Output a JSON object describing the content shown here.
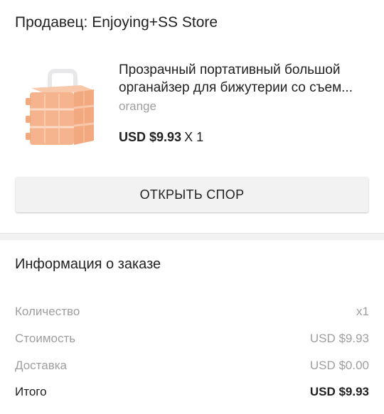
{
  "seller": {
    "text": "Продавец: Enjoying+SS Store"
  },
  "product": {
    "image_icon": "organizer-box-image",
    "title_line1": "Прозрачный портативный большой",
    "title_line2": "органайзер для бижутерии со съем...",
    "variant": "orange",
    "price": "USD $9.93",
    "quantity": "X 1"
  },
  "actions": {
    "open_dispute_label": "ОТКРЫТЬ СПОР"
  },
  "order_info": {
    "title": "Информация о заказе",
    "rows": [
      {
        "label": "Количество",
        "value": "x1"
      },
      {
        "label": "Стоимость",
        "value": "USD $9.93"
      },
      {
        "label": "Доставка",
        "value": "USD $0.00"
      },
      {
        "label": "Итого",
        "value": "USD $9.93"
      }
    ]
  },
  "colors": {
    "text_primary": "#212121",
    "text_secondary": "#9e9e9e",
    "button_bg": "#f2f2f2",
    "divider_bg": "#f2f2f2",
    "product_orange": "#f6b48e"
  }
}
